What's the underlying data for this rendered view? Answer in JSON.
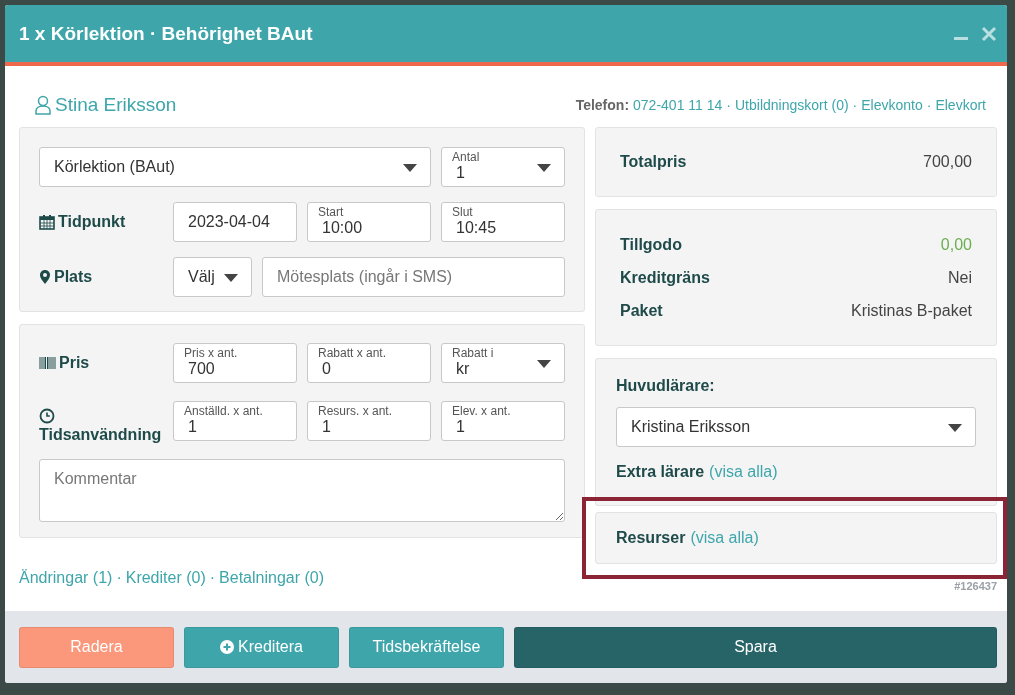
{
  "window": {
    "title": "1 x Körlektion · Behörighet BAut",
    "controls": [
      {
        "kind": "minimize"
      },
      {
        "kind": "close"
      }
    ]
  },
  "student": {
    "name": "Stina Eriksson",
    "phone_label": "Telefon:",
    "phone": "072-401 11 14",
    "separator": "·",
    "links": [
      "Utbildningskort (0)",
      "Elevkonto",
      "Elevkort"
    ]
  },
  "left_panels": [
    {
      "rows": [
        {
          "fields": [
            {
              "kind": "select",
              "value": "Körlektion (BAut)"
            },
            {
              "kind": "select",
              "label": "Antal",
              "value": "1"
            }
          ]
        },
        {
          "label": "Tidpunkt",
          "fields": [
            {
              "kind": "text",
              "value": "2023-04-04"
            },
            {
              "kind": "text",
              "label": "Start",
              "value": "10:00"
            },
            {
              "kind": "text",
              "label": "Slut",
              "value": "10:45"
            }
          ]
        },
        {
          "label": "Plats",
          "fields": [
            {
              "kind": "select",
              "value": "Välj"
            },
            {
              "kind": "text",
              "placeholder": "Mötesplats (ingår i SMS)"
            }
          ]
        }
      ]
    },
    {
      "rows": [
        {
          "label": "Pris",
          "fields": [
            {
              "kind": "text",
              "label": "Pris x ant.",
              "value": "700"
            },
            {
              "kind": "text",
              "label": "Rabatt x ant.",
              "value": "0"
            },
            {
              "kind": "select",
              "label": "Rabatt i",
              "value": "kr"
            }
          ]
        },
        {
          "label": "Tidsanvändning",
          "fields": [
            {
              "kind": "text",
              "label": "Anställd. x ant.",
              "value": "1"
            },
            {
              "kind": "text",
              "label": "Resurs. x ant.",
              "value": "1"
            },
            {
              "kind": "text",
              "label": "Elev. x ant.",
              "value": "1"
            }
          ]
        },
        {
          "fields": [
            {
              "kind": "textarea",
              "placeholder": "Kommentar"
            }
          ]
        }
      ]
    }
  ],
  "totals": {
    "label": "Totalpris",
    "value": "700,00"
  },
  "account": [
    {
      "label": "Tillgodo",
      "value": "0,00",
      "kind": "positive"
    },
    {
      "label": "Kreditgräns",
      "value": "Nei",
      "kind": "plain"
    },
    {
      "label": "Paket",
      "value": "Kristinas B-paket",
      "kind": "plain"
    }
  ],
  "teachers": {
    "main_label": "Huvudlärare:",
    "main_value": "Kristina Eriksson",
    "extra_label": "Extra lärare",
    "extra_link": "(visa alla)"
  },
  "resources": {
    "label": "Resurser",
    "link": "(visa alla)",
    "highlighted": true
  },
  "history": {
    "separator": "·",
    "links": [
      "Ändringar (1)",
      "Krediter (0)",
      "Betalningar (0)"
    ],
    "record_id": "#126437"
  },
  "buttons": [
    {
      "label": "Radera",
      "kind": "danger"
    },
    {
      "label": "Kreditera",
      "kind": "add"
    },
    {
      "label": "Tidsbekräftelse",
      "kind": "info"
    },
    {
      "label": "Spara",
      "kind": "primary"
    }
  ]
}
